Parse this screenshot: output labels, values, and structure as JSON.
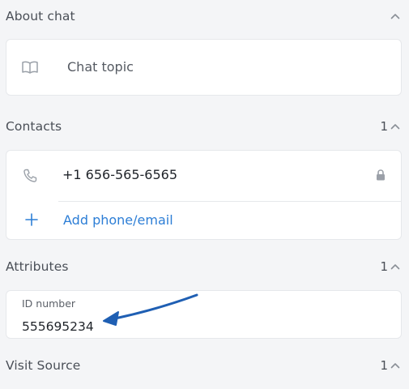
{
  "about_chat": {
    "title": "About chat",
    "topic_placeholder": "Chat topic",
    "icons": {
      "topic": "book-icon",
      "collapse": "chevron-up-icon"
    }
  },
  "contacts": {
    "title": "Contacts",
    "count": "1",
    "phone": "+1 656-565-6565",
    "add_label": "Add phone/email",
    "icons": {
      "phone": "phone-icon",
      "lock": "lock-icon",
      "add": "plus-icon",
      "collapse": "chevron-up-icon"
    }
  },
  "attributes": {
    "title": "Attributes",
    "count": "1",
    "field_label": "ID number",
    "field_value": "555695234"
  },
  "visit_source": {
    "title": "Visit Source",
    "count": "1"
  },
  "colors": {
    "background": "#f4f5f7",
    "card": "#ffffff",
    "link": "#2d7ed6",
    "annotation_arrow": "#1f5fb3"
  }
}
